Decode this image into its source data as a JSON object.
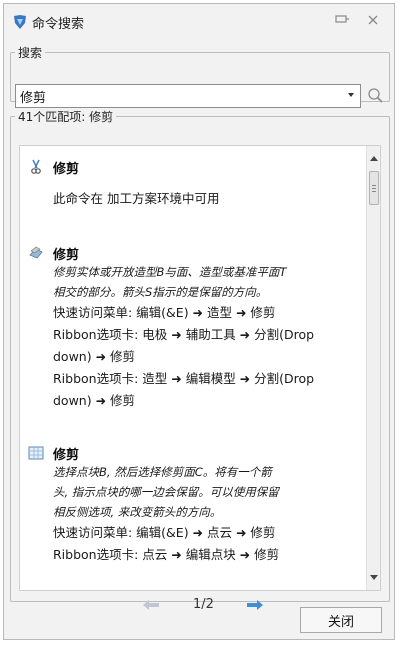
{
  "window": {
    "title": "命令搜索",
    "icon": "command-search-app-icon"
  },
  "search": {
    "group_label": "搜索",
    "value": "修剪",
    "search_icon": "magnifier-icon"
  },
  "results": {
    "group_label": "41个匹配项: 修剪",
    "entries": [
      {
        "icon": "trim-scissors-icon",
        "name": "修剪",
        "lines": [
          "此命令在 加工方案环境中可用"
        ]
      },
      {
        "icon": "trim-body-icon",
        "name": "修剪",
        "desc": [
          "修剪实体或开放造型B与面、造型或基准平面T",
          "相交的部分。箭头S指示的是保留的方向。"
        ],
        "lines": [
          "快速访问菜单: 编辑(&E) ➜ 造型 ➜ 修剪",
          "Ribbon选项卡: 电极 ➜ 辅助工具 ➜ 分割(Drop",
          "down) ➜ 修剪",
          "Ribbon选项卡: 造型 ➜ 编辑模型 ➜ 分割(Drop",
          "down) ➜ 修剪"
        ]
      },
      {
        "icon": "trim-points-icon",
        "name": "修剪",
        "desc": [
          "选择点块B, 然后选择修剪面C。将有一个箭",
          "头, 指示点块的哪一边会保留。可以使用保留",
          "相反侧选项, 来改变箭头的方向。"
        ],
        "lines": [
          "快速访问菜单: 编辑(&E) ➜ 点云 ➜ 修剪",
          "Ribbon选项卡: 点云 ➜ 编辑点块 ➜ 修剪"
        ]
      }
    ]
  },
  "pager": {
    "page": "1/2"
  },
  "buttons": {
    "close": "关闭"
  }
}
